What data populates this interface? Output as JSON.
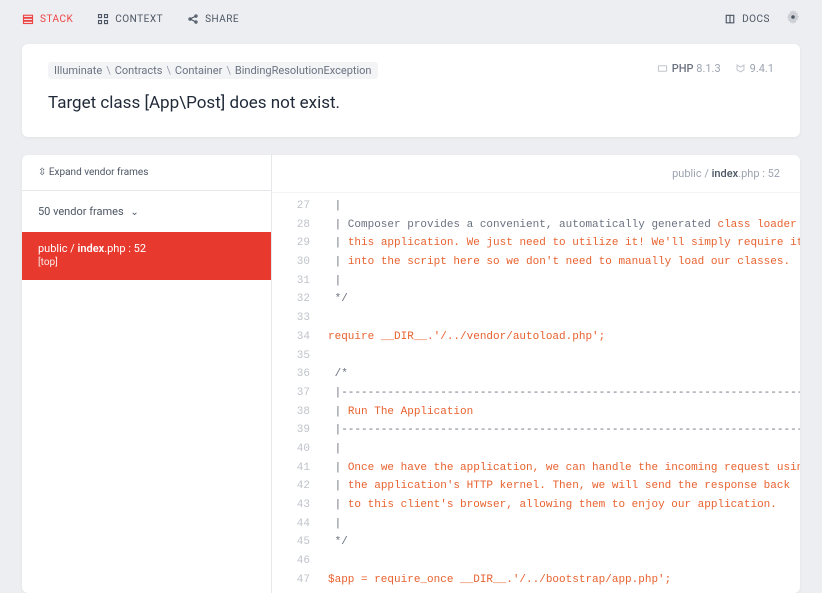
{
  "topbar": {
    "stack": "STACK",
    "context": "CONTEXT",
    "share": "SHARE",
    "docs": "DOCS"
  },
  "exception": {
    "crumbs": [
      "Illuminate",
      "Contracts",
      "Container",
      "BindingResolutionException"
    ],
    "message": "Target class [App\\Post] does not exist.",
    "php_label": "PHP",
    "php_version": "8.1.3",
    "fw_version": "9.4.1"
  },
  "sidebar": {
    "expand_label": "Expand vendor frames",
    "vendor_frames_label": "50 vendor frames",
    "active_frame": {
      "dir": "public / ",
      "file": "index",
      "ext": ".php",
      "line_sep": " : ",
      "line": "52",
      "fn": "[top]"
    }
  },
  "code_header": {
    "dir": "public / ",
    "file": "index",
    "ext": ".php",
    "line_sep": " : ",
    "line": "52"
  },
  "code": [
    {
      "n": 27,
      "seg": [
        {
          "c": "t-gr",
          "t": " | "
        }
      ]
    },
    {
      "n": 28,
      "seg": [
        {
          "c": "t-gr",
          "t": " | Composer provides a convenient, automatically generated "
        },
        {
          "c": "t-or",
          "t": "class loader for"
        }
      ]
    },
    {
      "n": 29,
      "seg": [
        {
          "c": "t-gr",
          "t": " | "
        },
        {
          "c": "t-or",
          "t": "this application. We just need to utilize it! We'll simply require it"
        }
      ]
    },
    {
      "n": 30,
      "seg": [
        {
          "c": "t-gr",
          "t": " | "
        },
        {
          "c": "t-or",
          "t": "into the script here so we don't need to manually load our classes."
        }
      ]
    },
    {
      "n": 31,
      "seg": [
        {
          "c": "t-gr",
          "t": " | "
        }
      ]
    },
    {
      "n": 32,
      "seg": [
        {
          "c": "t-gr",
          "t": " */"
        }
      ]
    },
    {
      "n": 33,
      "seg": [
        {
          "c": "",
          "t": ""
        }
      ]
    },
    {
      "n": 34,
      "seg": [
        {
          "c": "t-or",
          "t": "require __DIR__.'/../vendor/autoload.php';"
        }
      ]
    },
    {
      "n": 35,
      "seg": [
        {
          "c": "",
          "t": ""
        }
      ]
    },
    {
      "n": 36,
      "seg": [
        {
          "c": "t-gr",
          "t": " /*"
        }
      ]
    },
    {
      "n": 37,
      "seg": [
        {
          "c": "t-gr",
          "t": " |--------------------------------------------------------------------------"
        }
      ]
    },
    {
      "n": 38,
      "seg": [
        {
          "c": "t-gr",
          "t": " | "
        },
        {
          "c": "t-or",
          "t": "Run The Application"
        }
      ]
    },
    {
      "n": 39,
      "seg": [
        {
          "c": "t-gr",
          "t": " |--------------------------------------------------------------------------"
        }
      ]
    },
    {
      "n": 40,
      "seg": [
        {
          "c": "t-gr",
          "t": " |"
        }
      ]
    },
    {
      "n": 41,
      "seg": [
        {
          "c": "t-gr",
          "t": " | "
        },
        {
          "c": "t-or",
          "t": "Once we have the application, we can handle the incoming request using"
        }
      ]
    },
    {
      "n": 42,
      "seg": [
        {
          "c": "t-gr",
          "t": " | "
        },
        {
          "c": "t-or",
          "t": "the application's HTTP kernel. Then, we will send the response back"
        }
      ]
    },
    {
      "n": 43,
      "seg": [
        {
          "c": "t-gr",
          "t": " | "
        },
        {
          "c": "t-or",
          "t": "to this client's browser, allowing them to enjoy our application."
        }
      ]
    },
    {
      "n": 44,
      "seg": [
        {
          "c": "t-gr",
          "t": " |"
        }
      ]
    },
    {
      "n": 45,
      "seg": [
        {
          "c": "t-gr",
          "t": " */"
        }
      ]
    },
    {
      "n": 46,
      "seg": [
        {
          "c": "",
          "t": ""
        }
      ]
    },
    {
      "n": 47,
      "seg": [
        {
          "c": "t-or",
          "t": "$app = require_once __DIR__.'/../bootstrap/app.php';"
        }
      ]
    }
  ]
}
